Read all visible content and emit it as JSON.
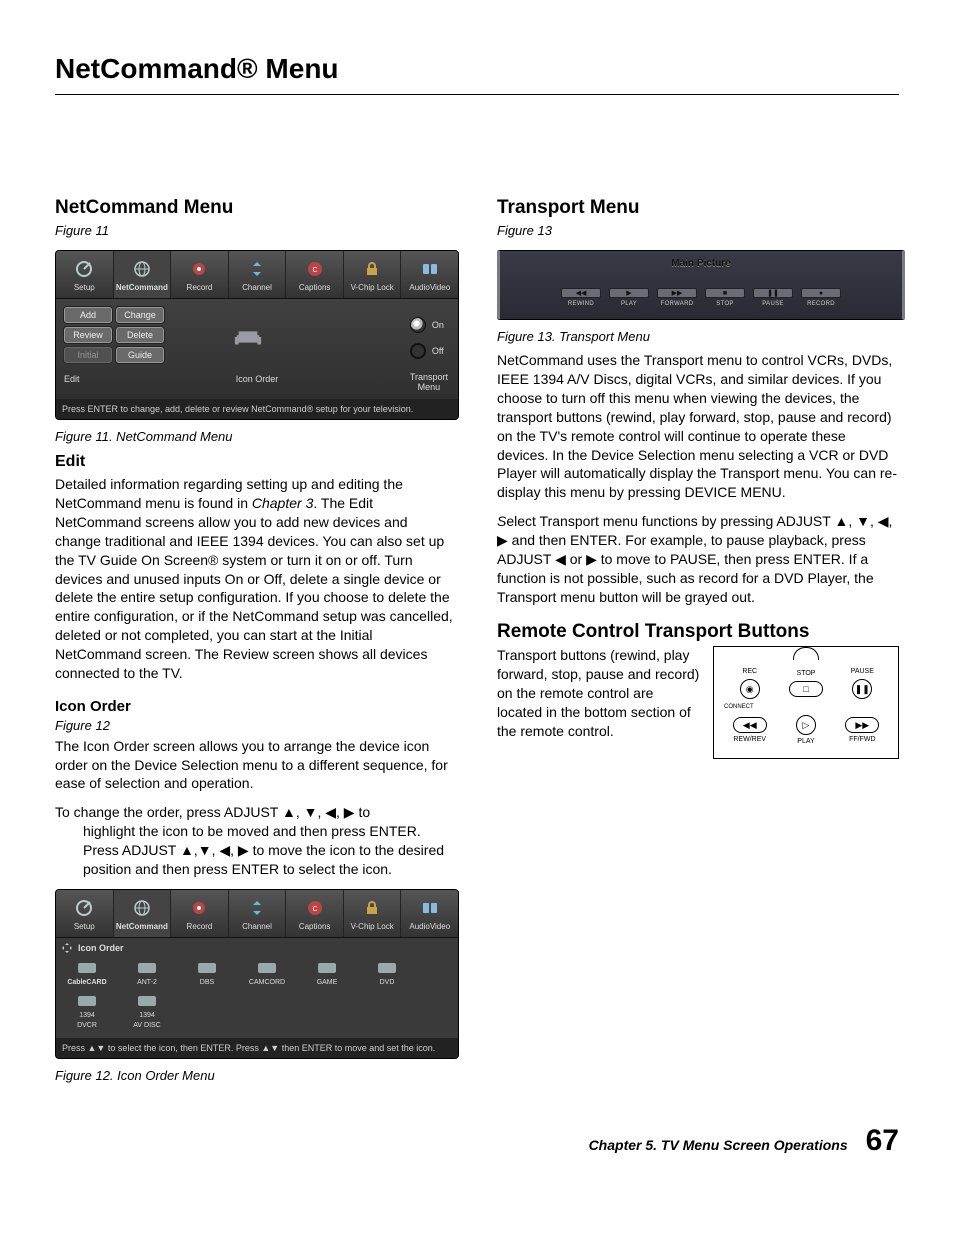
{
  "page_title": "NetCommand® Menu",
  "left": {
    "h_netcommand": "NetCommand Menu",
    "fig11_ref": "Figure 11",
    "fig11_caption": "Figure 11.  NetCommand Menu",
    "tabs": [
      {
        "label": "Setup",
        "icon": "dish"
      },
      {
        "label": "NetCommand",
        "icon": "globe",
        "selected": true
      },
      {
        "label": "Record",
        "icon": "record"
      },
      {
        "label": "Channel",
        "icon": "updown"
      },
      {
        "label": "Captions",
        "icon": "cc"
      },
      {
        "label": "V-Chip Lock",
        "icon": "lock"
      },
      {
        "label": "AudioVideo",
        "icon": "av"
      }
    ],
    "fig11_buttons_col1": [
      "Add",
      "Review",
      "Initial"
    ],
    "fig11_buttons_col2": [
      "Change",
      "Delete",
      "Guide"
    ],
    "fig11_on": "On",
    "fig11_off": "Off",
    "fig11_edit": "Edit",
    "fig11_iconorder": "Icon Order",
    "fig11_transport": "Transport\nMenu",
    "fig11_tip": "Press ENTER to change, add, delete or review NetCommand®  setup for your television.",
    "h_edit": "Edit",
    "edit_para": "Detailed information regarding setting up and editing the NetCommand menu is found in Chapter 3. The Edit NetCommand screens allow you to add new devices and change traditional and IEEE 1394 devices.  You can also set up the TV Guide On Screen® system or turn it on or off. Turn devices and unused inputs On or Off, delete a single device or delete the entire setup configuration.  If you choose to delete the entire configuration, or if the NetCommand setup was cancelled, deleted or not completed, you can start at the Initial NetCommand screen.  The Review screen shows all devices connected to the TV.",
    "h_iconorder": "Icon Order",
    "fig12_ref": "Figure 12",
    "iconorder_para": "The Icon Order screen allows you to arrange the device icon order on the Device Selection menu to a different sequence, for ease of selection and operation.",
    "iconorder_steps_lead": "To change the order, press ADJUST ▲, ▼, ◀, ▶ to",
    "iconorder_steps_body": "highlight the icon to be moved and then press ENTER.  Press ADJUST ▲,▼, ◀, ▶ to move the icon to the desired position and then press ENTER to select the icon.",
    "fig12_title": "Icon Order",
    "fig12_devices": [
      {
        "label": "CableCARD",
        "sel": true
      },
      {
        "label": "ANT-2"
      },
      {
        "label": "DBS"
      },
      {
        "label": "CAMCORD"
      },
      {
        "label": "GAME"
      },
      {
        "label": "DVD"
      },
      {
        "label": "1394\nDVCR"
      },
      {
        "label": "1394\nAV DISC"
      }
    ],
    "fig12_tip": "Press ▲▼ to select the icon, then ENTER.  Press  ▲▼ then ENTER to move and set the icon.",
    "fig12_caption": "Figure 12.  Icon Order Menu"
  },
  "right": {
    "h_transport": "Transport Menu",
    "fig13_ref": "Figure 13",
    "fig13_mainpic": "Main Picture",
    "fig13_buttons": [
      {
        "sym": "◀◀",
        "lab": "REWIND"
      },
      {
        "sym": "▶",
        "lab": "PLAY"
      },
      {
        "sym": "▶▶",
        "lab": "FORWARD"
      },
      {
        "sym": "■",
        "lab": "STOP"
      },
      {
        "sym": "❚❚",
        "lab": "PAUSE"
      },
      {
        "sym": "●",
        "lab": "RECORD"
      }
    ],
    "fig13_caption": "Figure 13.  Transport Menu",
    "transport_para1": "NetCommand uses the Transport menu to control VCRs, DVDs, IEEE 1394 A/V Discs, digital VCRs, and similar devices.  If you choose to turn off this menu when viewing the devices, the transport buttons (rewind, play forward, stop, pause and record) on the TV's remote control will continue to operate these devices.  In the Device Selection menu selecting a VCR or DVD Player will automatically display the Transport menu.  You can re-display this menu by pressing DEVICE MENU.",
    "transport_para2": "Select Transport menu functions by pressing ADJUST ▲, ▼, ◀, ▶ and then ENTER.  For example, to pause playback, press ADJUST  ◀ or ▶ to move to PAUSE, then press ENTER.  If a function is not possible, such as record for a DVD Player, the Transport menu button will be grayed out.",
    "h_remote": "Remote Control Transport Buttons",
    "remote_para": "Transport  buttons (rewind, play forward, stop, pause and record) on the remote control are located in the bottom section of the remote control.",
    "remote_labels": {
      "rec": "REC",
      "stop": "STOP",
      "pause": "PAUSE",
      "connect": "CONNECT",
      "rew": "REW/REV",
      "play": "PLAY",
      "ff": "FF/FWD"
    }
  },
  "footer": {
    "chapter": "Chapter 5.  TV Menu Screen Operations",
    "page": "67"
  }
}
